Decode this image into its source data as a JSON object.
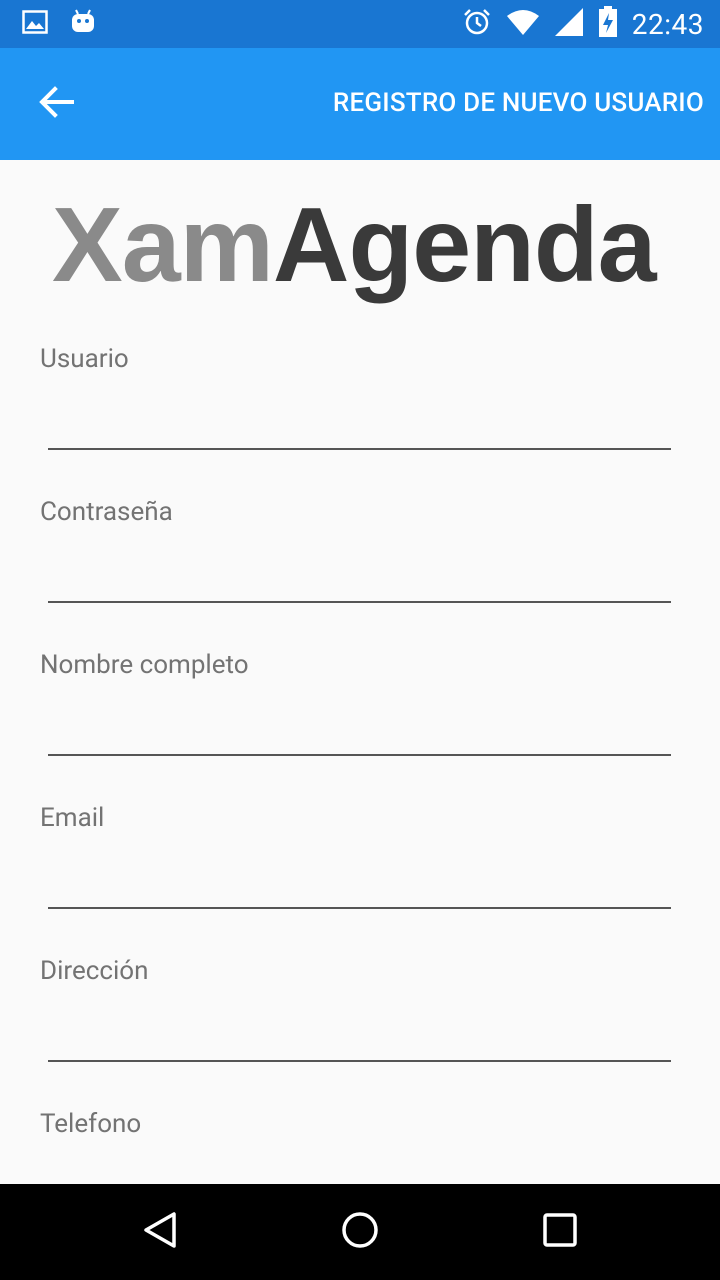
{
  "status_bar": {
    "time": "22:43",
    "left_icons": [
      "image-icon",
      "android-icon"
    ],
    "right_icons": [
      "alarm-icon",
      "wifi-icon",
      "signal-icon",
      "battery-charging-icon"
    ]
  },
  "app_bar": {
    "title": "REGISTRO DE NUEVO USUARIO",
    "back_icon": "arrow-back-icon",
    "color": "#2196f3",
    "status_color": "#1976d2"
  },
  "logo": {
    "part1": "Xam",
    "part2": "Agenda"
  },
  "form": {
    "fields": [
      {
        "label": "Usuario",
        "value": ""
      },
      {
        "label": "Contraseña",
        "value": ""
      },
      {
        "label": "Nombre completo",
        "value": ""
      },
      {
        "label": "Email",
        "value": ""
      },
      {
        "label": "Dirección",
        "value": ""
      },
      {
        "label": "Telefono",
        "value": ""
      }
    ]
  },
  "nav_bar": {
    "icons": [
      "back-triangle-icon",
      "home-circle-icon",
      "recents-square-icon"
    ]
  }
}
